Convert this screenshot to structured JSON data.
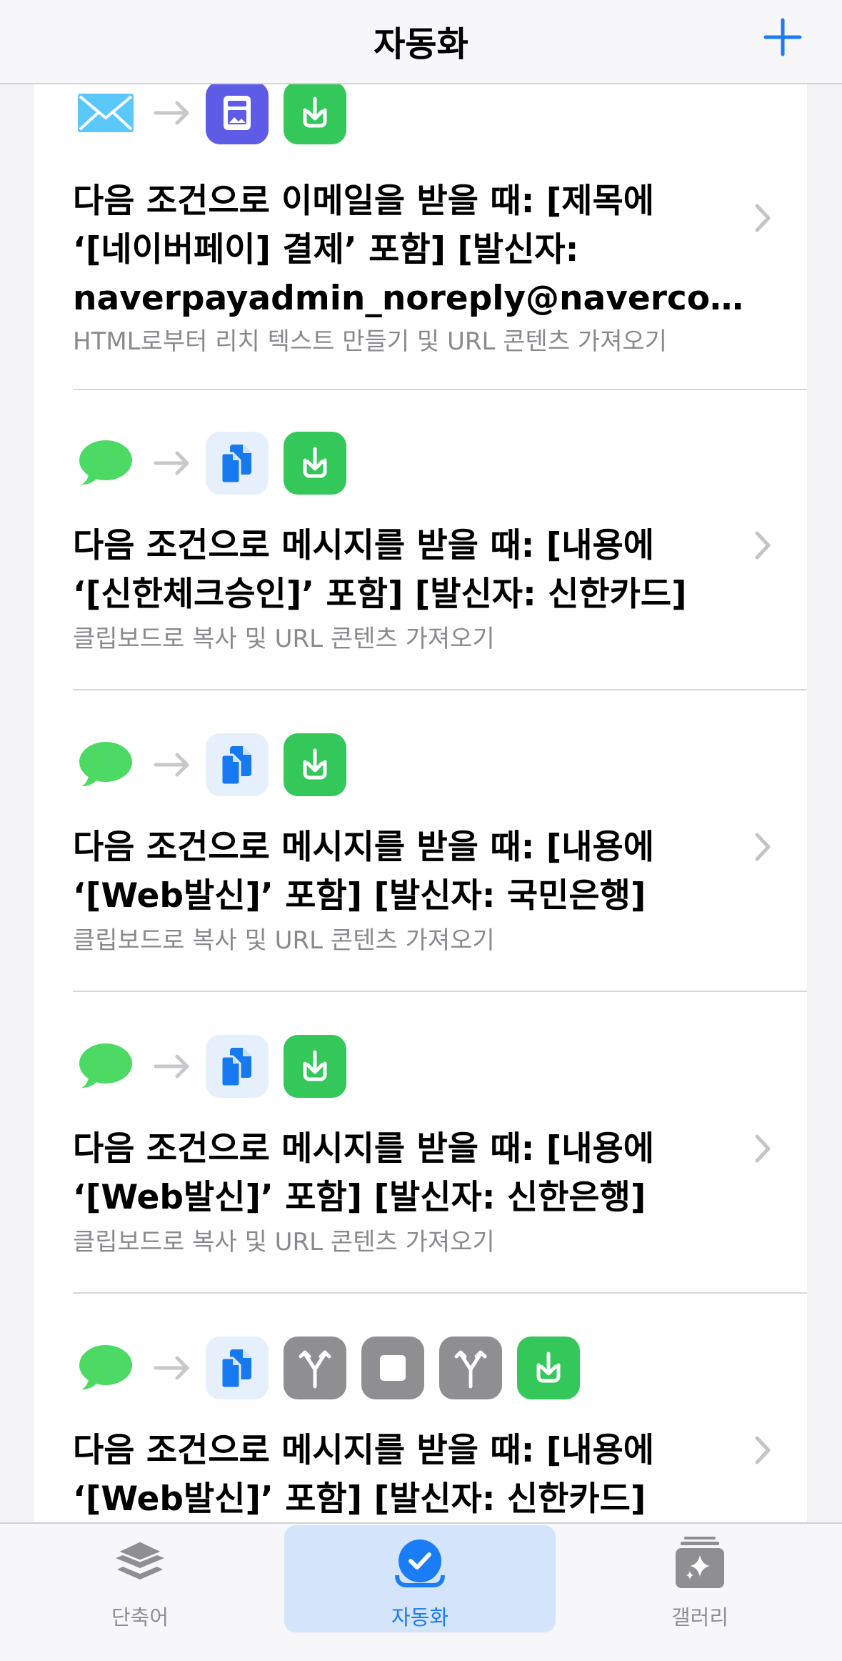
{
  "header": {
    "title": "자동화",
    "add_icon": "plus-icon",
    "accent": "#1b7df5"
  },
  "automations": [
    {
      "trigger_icon": "mail-icon",
      "actions": [
        "text-image-icon",
        "download-icon"
      ],
      "title_line1": "다음 조건으로 이메일을 받을 때: [제목에",
      "title_line2": "‘[네이버페이] 결제’ 포함] [발신자:",
      "title_line3": "naverpayadmin_noreply@navercorp.com]",
      "subtitle": "HTML로부터 리치 텍스트 만들기 및 URL 콘텐츠 가져오기"
    },
    {
      "trigger_icon": "message-icon",
      "actions": [
        "copy-icon",
        "download-icon"
      ],
      "title_line1": "다음 조건으로 메시지를 받을 때: [내용에",
      "title_line2": "‘[신한체크승인]’ 포함] [발신자: 신한카드]",
      "subtitle": "클립보드로 복사 및 URL 콘텐츠 가져오기"
    },
    {
      "trigger_icon": "message-icon",
      "actions": [
        "copy-icon",
        "download-icon"
      ],
      "title_line1": "다음 조건으로 메시지를 받을 때: [내용에",
      "title_line2": "‘[Web발신]’ 포함] [발신자: 국민은행]",
      "subtitle": "클립보드로 복사 및 URL 콘텐츠 가져오기"
    },
    {
      "trigger_icon": "message-icon",
      "actions": [
        "copy-icon",
        "download-icon"
      ],
      "title_line1": "다음 조건으로 메시지를 받을 때: [내용에",
      "title_line2": "‘[Web발신]’ 포함] [발신자: 신한은행]",
      "subtitle": "클립보드로 복사 및 URL 콘텐츠 가져오기"
    },
    {
      "trigger_icon": "message-icon",
      "actions": [
        "copy-icon",
        "branch-icon",
        "stop-icon",
        "branch-icon",
        "download-icon"
      ],
      "title_line1": "다음 조건으로 메시지를 받을 때: [내용에",
      "title_line2": "‘[Web발신]’ 포함] [발신자: 신한카드]"
    }
  ],
  "tabs": [
    {
      "label": "단축어",
      "icon": "layers-icon",
      "selected": false
    },
    {
      "label": "자동화",
      "icon": "checkmark-circle-icon",
      "selected": true
    },
    {
      "label": "갤러리",
      "icon": "sparkles-gallery-icon",
      "selected": false
    }
  ]
}
